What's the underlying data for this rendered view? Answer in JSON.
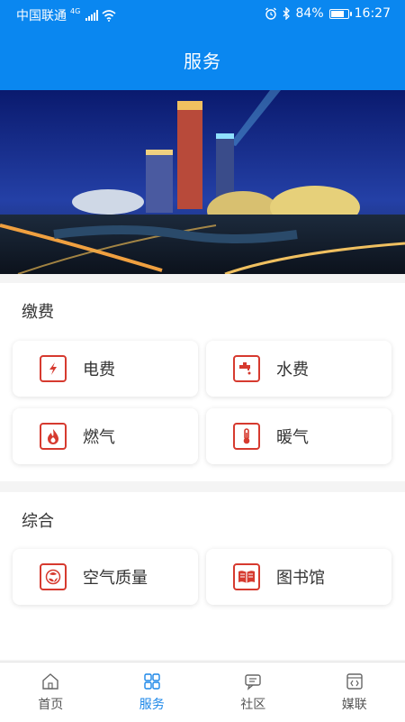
{
  "status_bar": {
    "carrier": "中国联通",
    "network": "4G",
    "battery": "84%",
    "battery_level": 0.84,
    "time": "16:27"
  },
  "header": {
    "title": "服务"
  },
  "banner": {
    "icon": "city-night-skyline-image"
  },
  "sections": [
    {
      "title": "缴费",
      "items": [
        {
          "label": "电费",
          "icon": "electricity-icon"
        },
        {
          "label": "水费",
          "icon": "water-tap-icon"
        },
        {
          "label": "燃气",
          "icon": "gas-flame-icon"
        },
        {
          "label": "暖气",
          "icon": "thermometer-icon"
        }
      ]
    },
    {
      "title": "综合",
      "items": [
        {
          "label": "空气质量",
          "icon": "air-quality-icon"
        },
        {
          "label": "图书馆",
          "icon": "library-book-icon"
        }
      ]
    }
  ],
  "bottom_nav": {
    "active": "服务",
    "items": [
      {
        "label": "首页",
        "icon": "home-icon"
      },
      {
        "label": "服务",
        "icon": "grid-icon"
      },
      {
        "label": "社区",
        "icon": "chat-icon"
      },
      {
        "label": "媒联",
        "icon": "media-icon"
      }
    ]
  },
  "colors": {
    "primary": "#0a87f0",
    "icon_red": "#d63a2f",
    "active_nav": "#1a86e8"
  }
}
